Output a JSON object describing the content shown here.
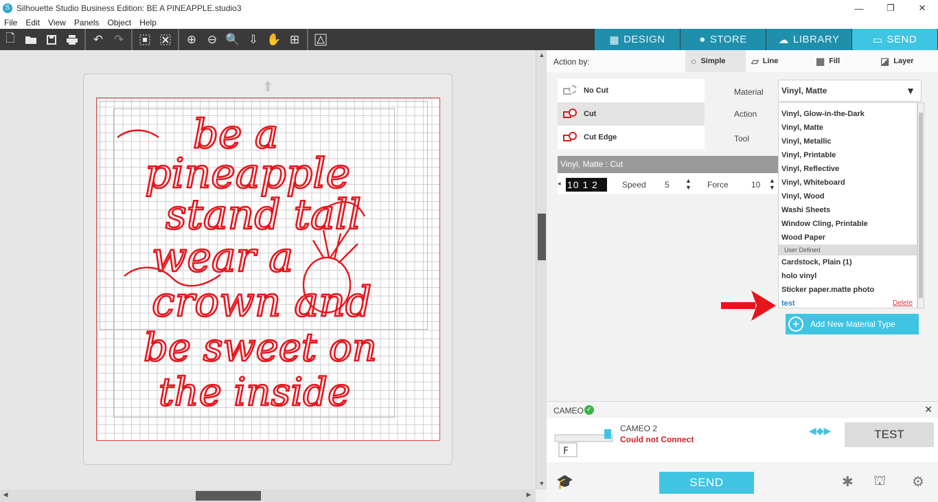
{
  "window": {
    "title": "Silhouette Studio Business Edition: BE A PINEAPPLE.studio3",
    "controls": [
      "—",
      "❐",
      "✕"
    ]
  },
  "menu": [
    "File",
    "Edit",
    "View",
    "Panels",
    "Object",
    "Help"
  ],
  "toolbar": {
    "icons": [
      "new-document-icon",
      "open-folder-icon",
      "save-icon",
      "print-icon",
      "undo-icon",
      "redo-icon",
      "group-icon",
      "ungroup-icon",
      "zoom-in-icon",
      "zoom-out-icon",
      "zoom-fit-icon",
      "move-down-icon",
      "pan-hand-icon",
      "add-page-icon",
      "trace-icon"
    ]
  },
  "nav_tabs": [
    {
      "label": "DESIGN",
      "icon": "grid-icon",
      "active": false
    },
    {
      "label": "STORE",
      "icon": "store-icon",
      "active": false
    },
    {
      "label": "LIBRARY",
      "icon": "cloud-icon",
      "active": false
    },
    {
      "label": "SEND",
      "icon": "cutter-icon",
      "active": true
    }
  ],
  "design": {
    "lines": [
      "be a",
      "pineapple",
      "stand tall",
      "wear a",
      "crown and",
      "be sweet on",
      "the inside"
    ],
    "color": "#e8141c"
  },
  "panel": {
    "action_by_label": "Action by:",
    "action_tabs": [
      "Simple",
      "Line",
      "Fill",
      "Layer"
    ],
    "options": [
      "No Cut",
      "Cut",
      "Cut Edge"
    ],
    "selected_option": "Cut",
    "field_labels": {
      "material": "Material",
      "action": "Action",
      "tool": "Tool"
    },
    "settings_header": "Vinyl, Matte : Cut",
    "depth_value": "10 1 2",
    "speed_label": "Speed",
    "speed_value": "5",
    "force_label": "Force",
    "force_value": "10",
    "material_selected": "Vinyl, Matte",
    "material_items": [
      "Vinyl, Glow-in-the-Dark",
      "Vinyl, Matte",
      "Vinyl, Metallic",
      "Vinyl, Printable",
      "Vinyl, Reflective",
      "Vinyl, Whiteboard",
      "Vinyl, Wood",
      "Washi Sheets",
      "Window Cling, Printable",
      "Wood Paper"
    ],
    "user_defined_label": "User Defined",
    "user_items": [
      "Cardstock, Plain (1)",
      "holo vinyl",
      "Sticker paper.matte photo"
    ],
    "test_item": "test",
    "delete_label": "Delete",
    "add_material_label": "Add New Material Type"
  },
  "device": {
    "name": "CAMEO",
    "model": "CAMEO 2",
    "status": "Could not Connect",
    "test_label": "TEST",
    "send_label": "SEND",
    "machine_letter": "F"
  },
  "colors": {
    "accent": "#3fc4e2",
    "nav_inactive": "#1f8fab",
    "cut_line": "#e8141c",
    "error": "#d31f1f"
  }
}
